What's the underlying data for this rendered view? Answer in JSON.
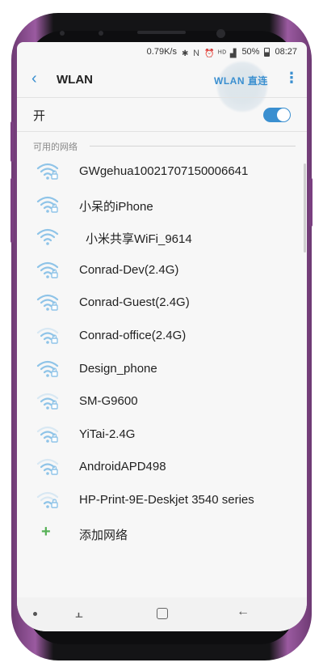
{
  "status_bar": {
    "net_speed": "0.79K/s",
    "icons": [
      "bluetooth-icon",
      "nfc-icon",
      "alarm-icon",
      "4g-icon",
      "signal-icon"
    ],
    "battery": "50%",
    "time": "08:27"
  },
  "header": {
    "title": "WLAN",
    "wlan_direct_label": "WLAN 直连"
  },
  "toggle": {
    "label": "开",
    "state": "on"
  },
  "section": {
    "available_label": "可用的网络"
  },
  "networks": [
    {
      "ssid": "GWgehua10021707150006641",
      "locked": true,
      "signal": "full"
    },
    {
      "ssid": "小呆的iPhone",
      "locked": true,
      "signal": "full"
    },
    {
      "ssid": "小米共享WiFi_9614",
      "locked": false,
      "signal": "full"
    },
    {
      "ssid": "Conrad-Dev(2.4G)",
      "locked": true,
      "signal": "full"
    },
    {
      "ssid": "Conrad-Guest(2.4G)",
      "locked": true,
      "signal": "full"
    },
    {
      "ssid": "Conrad-office(2.4G)",
      "locked": true,
      "signal": "medium"
    },
    {
      "ssid": "Design_phone",
      "locked": true,
      "signal": "full"
    },
    {
      "ssid": "SM-G9600",
      "locked": true,
      "signal": "medium"
    },
    {
      "ssid": "YiTai-2.4G",
      "locked": true,
      "signal": "medium"
    },
    {
      "ssid": "AndroidAPD498",
      "locked": true,
      "signal": "medium"
    },
    {
      "ssid": "HP-Print-9E-Deskjet 3540 series",
      "locked": true,
      "signal": "low"
    }
  ],
  "add_network": {
    "label": "添加网络"
  },
  "colors": {
    "accent": "#3a8fd0",
    "wifi_icon": "#8fc4e8",
    "add_green": "#57b157"
  }
}
